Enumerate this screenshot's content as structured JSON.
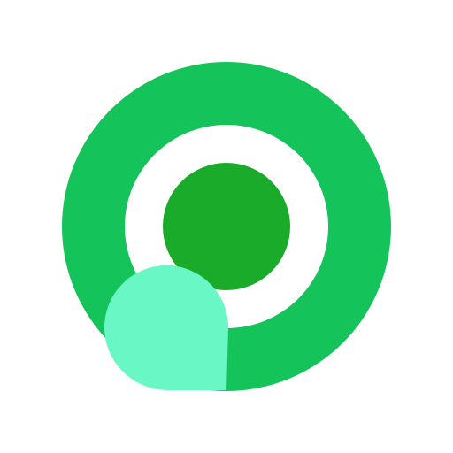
{
  "logo": {
    "icon": "green-target-with-speech-bubble-icon",
    "colors": {
      "background": "#ffffff",
      "outer_ring": "#14c45a",
      "inner_gap": "#ffffff",
      "center_dot": "#1aab2a",
      "bubble": "#6af7c6"
    }
  }
}
